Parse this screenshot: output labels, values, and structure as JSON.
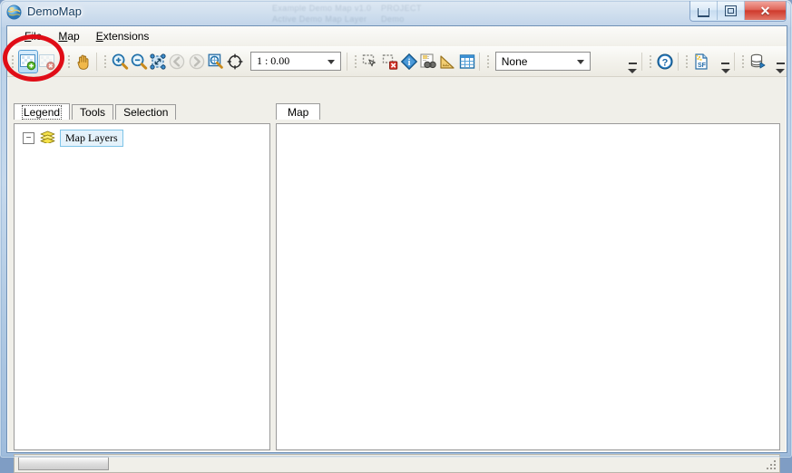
{
  "window": {
    "title": "DemoMap",
    "icon": "globe-icon",
    "caption_buttons": [
      {
        "name": "minimize",
        "glyph": "—"
      },
      {
        "name": "maximize",
        "glyph": "❐"
      },
      {
        "name": "close",
        "glyph": "✕"
      }
    ],
    "ghost_text": [
      "Example Demo Map v1.0",
      "PROJECT",
      "Active Demo Map Layer",
      "Demo"
    ]
  },
  "menubar": {
    "items": [
      {
        "name": "menu-file",
        "mnemonic": "F",
        "rest": "ile"
      },
      {
        "name": "menu-map",
        "mnemonic": "M",
        "rest": "ap"
      },
      {
        "name": "menu-extensions",
        "mnemonic": "E",
        "rest": "xtensions"
      }
    ]
  },
  "toolbar": {
    "groups": [
      {
        "name": "layer-group",
        "buttons": [
          {
            "name": "add-layer-button",
            "icon": "add-layer-icon",
            "label": "Add Layer",
            "state": "selected"
          },
          {
            "name": "remove-layer-button",
            "icon": "remove-layer-icon",
            "label": "Remove Layer",
            "state": "disabled"
          }
        ]
      },
      {
        "name": "pan-group",
        "buttons": [
          {
            "name": "pan-button",
            "icon": "hand-pan-icon",
            "label": "Pan",
            "state": "normal"
          }
        ]
      },
      {
        "name": "zoom-group",
        "buttons": [
          {
            "name": "zoom-in-button",
            "icon": "zoom-in-icon",
            "label": "Zoom In",
            "state": "normal"
          },
          {
            "name": "zoom-out-button",
            "icon": "zoom-out-icon",
            "label": "Zoom Out",
            "state": "normal"
          },
          {
            "name": "zoom-full-extent-button",
            "icon": "zoom-full-extent-icon",
            "label": "Full Extent",
            "state": "normal"
          },
          {
            "name": "zoom-previous-button",
            "icon": "arrow-left-icon",
            "label": "Previous Extent",
            "state": "disabled"
          },
          {
            "name": "zoom-next-button",
            "icon": "arrow-right-icon",
            "label": "Next Extent",
            "state": "disabled"
          },
          {
            "name": "zoom-to-layer-button",
            "icon": "zoom-to-layer-icon",
            "label": "Zoom To Layer",
            "state": "normal"
          },
          {
            "name": "center-target-button",
            "icon": "crosshair-icon",
            "label": "Center",
            "state": "normal"
          }
        ]
      },
      {
        "name": "select-group",
        "buttons": [
          {
            "name": "select-button",
            "icon": "select-arrow-icon",
            "label": "Select",
            "state": "normal"
          },
          {
            "name": "clear-selection-button",
            "icon": "clear-selection-icon",
            "label": "Clear Selection",
            "state": "normal"
          },
          {
            "name": "identify-button",
            "icon": "identify-info-icon",
            "label": "Identify",
            "state": "normal"
          },
          {
            "name": "find-button",
            "icon": "find-binoculars-icon",
            "label": "Find",
            "state": "normal"
          },
          {
            "name": "measure-button",
            "icon": "measure-ruler-icon",
            "label": "Measure",
            "state": "normal"
          },
          {
            "name": "attribute-table-button",
            "icon": "table-grid-icon",
            "label": "Attribute Table",
            "state": "normal"
          }
        ]
      },
      {
        "name": "help-group",
        "buttons": [
          {
            "name": "help-button",
            "icon": "help-question-icon",
            "label": "Help",
            "state": "normal"
          }
        ]
      },
      {
        "name": "shapefile-group",
        "buttons": [
          {
            "name": "shapefile-button",
            "icon": "shapefile-sf-icon",
            "label": "Shapefile",
            "state": "normal"
          }
        ]
      },
      {
        "name": "database-group",
        "buttons": [
          {
            "name": "database-button",
            "icon": "database-run-icon",
            "label": "Database",
            "state": "normal"
          }
        ]
      }
    ],
    "scale_combo": {
      "name": "scale-combo",
      "value": "1 : 0.00",
      "placeholder": "1 : 0.00"
    },
    "layer_combo": {
      "name": "active-layer-combo",
      "value": "None",
      "placeholder": "None"
    }
  },
  "left_panel": {
    "tabs": [
      {
        "name": "tab-legend",
        "label": "Legend",
        "active": true
      },
      {
        "name": "tab-tools",
        "label": "Tools",
        "active": false
      },
      {
        "name": "tab-selection",
        "label": "Selection",
        "active": false
      }
    ],
    "tree": {
      "expander": "−",
      "root_label": "Map Layers",
      "root_icon": "layers-stack-icon"
    }
  },
  "main_panel": {
    "tabs": [
      {
        "name": "tab-map",
        "label": "Map",
        "active": true
      }
    ],
    "canvas": {
      "name": "map-canvas",
      "background": "#ffffff"
    }
  },
  "statusbar": {
    "progress": {
      "name": "progress-bar",
      "value": 0,
      "text": ""
    },
    "message": "",
    "grip": "resize-grip-icon"
  },
  "annotation": {
    "name": "highlight-ellipse",
    "color": "#e00d17",
    "targets": "add-layer-button"
  },
  "colors": {
    "accent": "#1c6eb4",
    "glass_top": "#b9cfe6",
    "glass_bottom": "#9fbcdc",
    "client_bg": "#f0efe9",
    "panel_bg": "#ffffff",
    "border": "#9a9a9a",
    "highlight": "#e00d17"
  }
}
